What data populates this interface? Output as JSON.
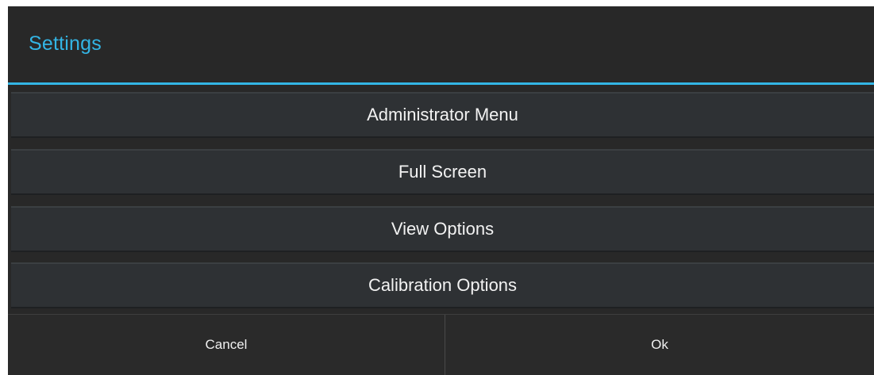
{
  "dialog": {
    "title": "Settings",
    "accent_color": "#33b5e5",
    "menu_items": [
      {
        "label": "Administrator Menu"
      },
      {
        "label": "Full Screen"
      },
      {
        "label": "View Options"
      },
      {
        "label": "Calibration Options"
      }
    ],
    "buttons": {
      "cancel_label": "Cancel",
      "ok_label": "Ok"
    }
  }
}
